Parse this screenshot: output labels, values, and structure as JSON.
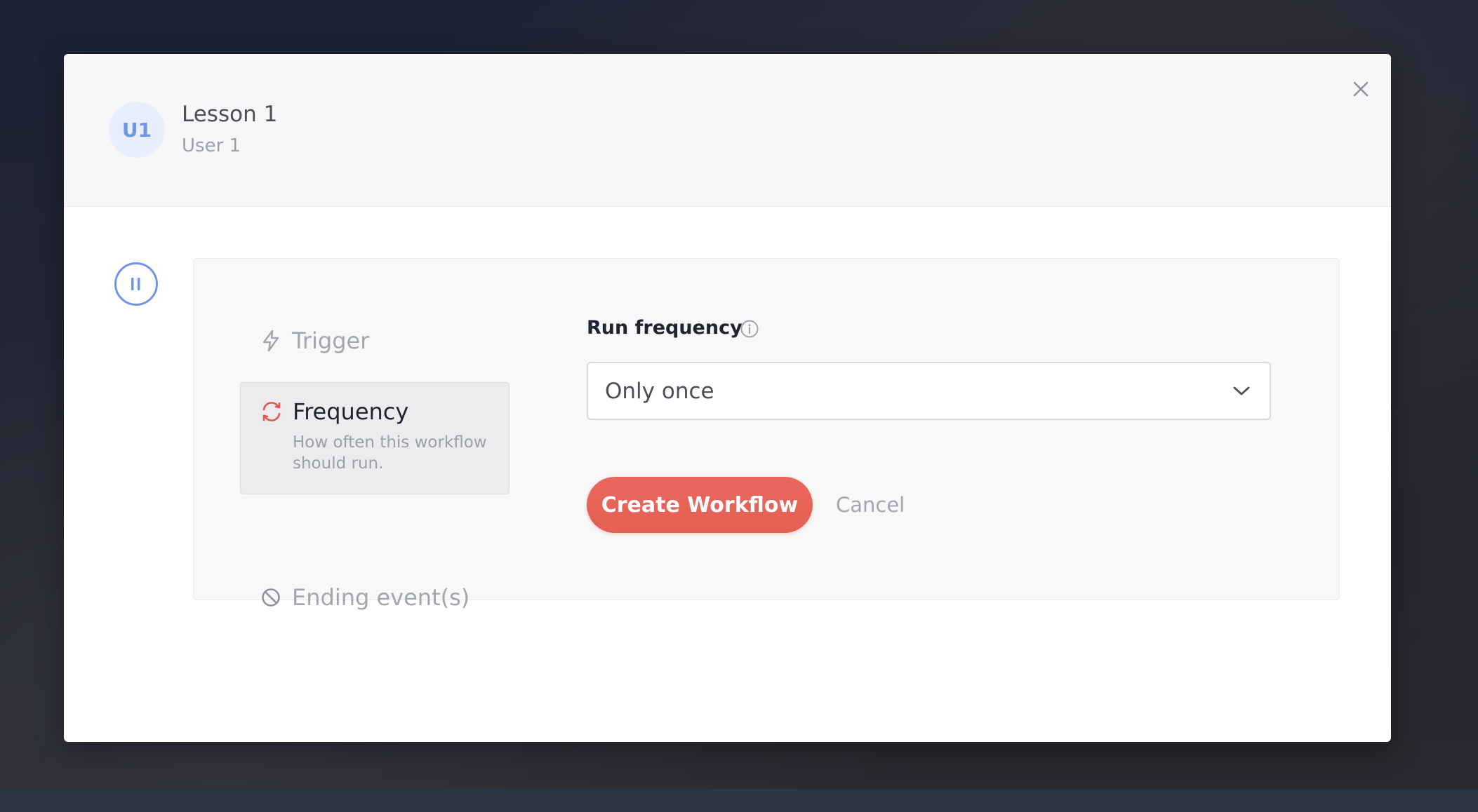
{
  "header": {
    "avatar_initials": "U1",
    "title": "Lesson 1",
    "subtitle": "User 1"
  },
  "steps": [
    {
      "label": "Trigger",
      "icon": "lightning-icon",
      "state": "inactive"
    },
    {
      "label": "Frequency",
      "icon": "refresh-icon",
      "state": "active",
      "description": "How often this workflow should run."
    },
    {
      "label": "Ending event(s)",
      "icon": "ban-icon",
      "state": "inactive"
    }
  ],
  "form": {
    "run_frequency_label": "Run frequency",
    "run_frequency_value": "Only once"
  },
  "actions": {
    "create_label": "Create Workflow",
    "cancel_label": "Cancel"
  },
  "colors": {
    "accent_blue": "#6f95e4",
    "primary_button": "#e45f53",
    "active_icon": "#e0574d"
  }
}
